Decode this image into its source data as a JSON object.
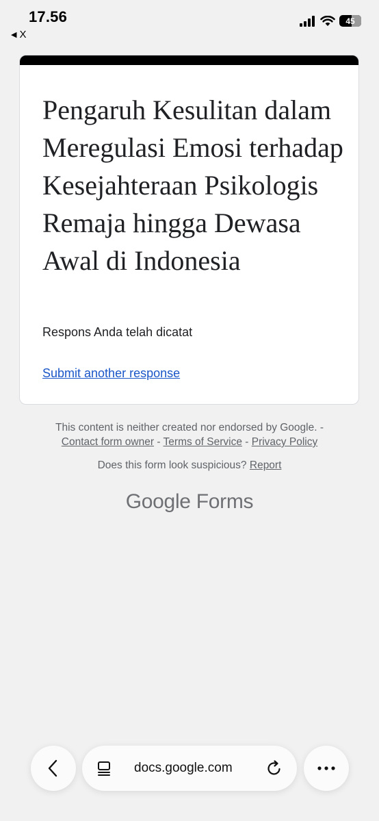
{
  "status": {
    "time": "17.56",
    "back_app": "X",
    "battery": "45"
  },
  "form": {
    "title": "Pengaruh Kesulitan dalam Meregulasi Emosi terhadap Kesejahteraan Psikologis Remaja hingga Dewasa Awal di Indonesia",
    "confirmation": "Respons Anda telah dicatat",
    "submit_another": "Submit another response"
  },
  "footer": {
    "disclaimer": "This content is neither created nor endorsed by Google. -",
    "contact": "Contact form owner",
    "sep": " - ",
    "terms": "Terms of Service",
    "privacy": "Privacy Policy",
    "suspicious": "Does this form look suspicious?",
    "report": "Report",
    "brand_google": "Google",
    "brand_forms": "Forms"
  },
  "browser": {
    "url": "docs.google.com"
  },
  "colors": {
    "link": "#1a56c8",
    "background": "#f1f1f1",
    "card_accent": "#000000"
  }
}
